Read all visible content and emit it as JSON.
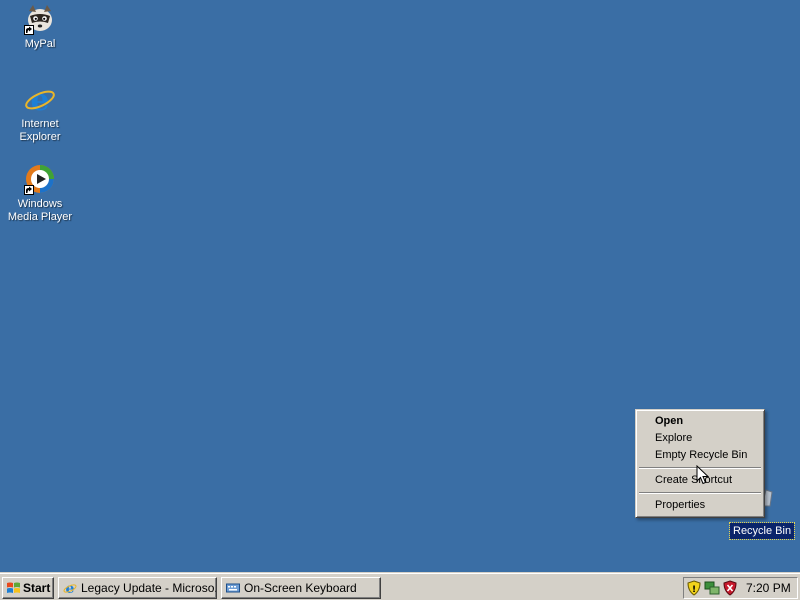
{
  "desktop": {
    "background": "#3a6ea5",
    "icons": [
      {
        "name": "mypal",
        "label": "MyPal",
        "icon": "raccoon-icon"
      },
      {
        "name": "internet-explorer",
        "label": "Internet Explorer",
        "icon": "ie-icon"
      },
      {
        "name": "windows-media-player",
        "label": "Windows Media Player",
        "icon": "wmp-icon"
      }
    ],
    "recycle_bin": {
      "label": "Recycle Bin",
      "selected": true
    }
  },
  "context_menu": {
    "items": [
      {
        "label": "Open",
        "default": true
      },
      {
        "label": "Explore"
      },
      {
        "label": "Empty Recycle Bin"
      },
      {
        "separator": true
      },
      {
        "label": "Create Shortcut"
      },
      {
        "separator": true
      },
      {
        "label": "Properties"
      }
    ]
  },
  "taskbar": {
    "start_label": "Start",
    "tasks": [
      {
        "label": "Legacy Update - Microso...",
        "icon": "ie-icon"
      },
      {
        "label": "On-Screen Keyboard",
        "icon": "keyboard-icon"
      }
    ],
    "tray": {
      "icons": [
        "security-shield-icon",
        "network-icon",
        "antivirus-icon"
      ],
      "clock": "7:20 PM"
    }
  }
}
